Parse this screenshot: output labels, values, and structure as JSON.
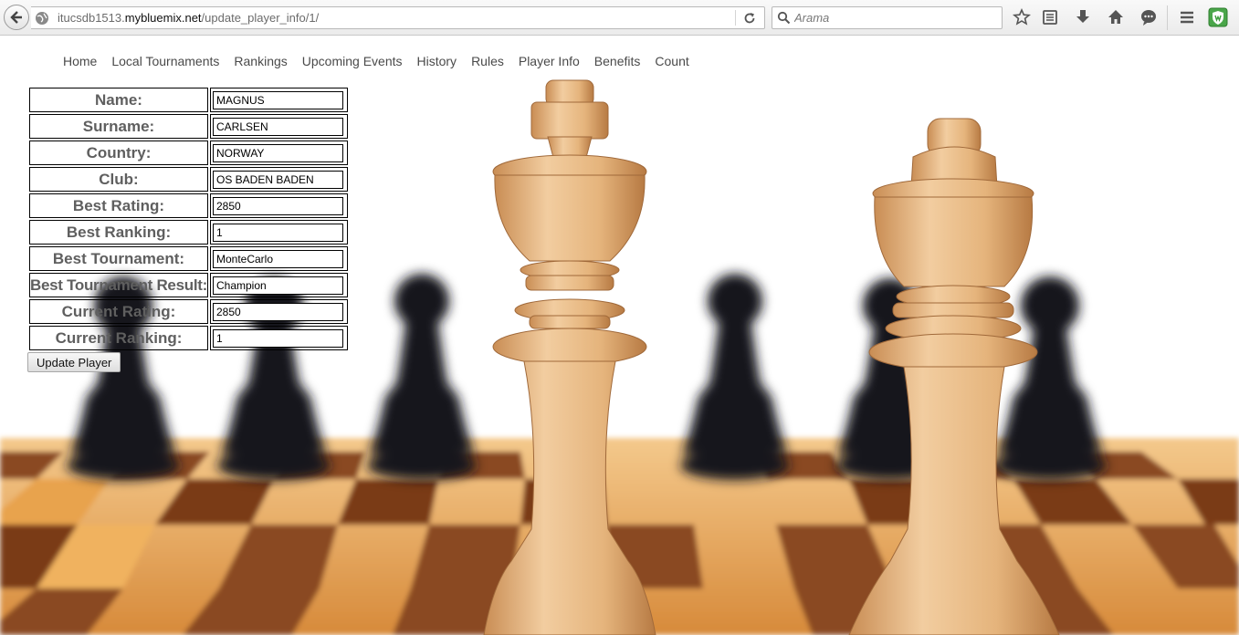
{
  "browser": {
    "url_prefix": "itucsdb1513.",
    "url_domain": "mybluemix.net",
    "url_path": "/update_player_info/1/",
    "search_placeholder": "Arama"
  },
  "nav": {
    "items": [
      "Home",
      "Local Tournaments",
      "Rankings",
      "Upcoming Events",
      "History",
      "Rules",
      "Player Info",
      "Benefits",
      "Count"
    ]
  },
  "form": {
    "rows": [
      {
        "label": "Name:",
        "value": "MAGNUS"
      },
      {
        "label": "Surname:",
        "value": "CARLSEN"
      },
      {
        "label": "Country:",
        "value": "NORWAY"
      },
      {
        "label": "Club:",
        "value": "OS BADEN BADEN"
      },
      {
        "label": "Best Rating:",
        "value": "2850"
      },
      {
        "label": "Best Ranking:",
        "value": "1"
      },
      {
        "label": "Best Tournament:",
        "value": "MonteCarlo"
      },
      {
        "label": "Best Tournament Result:",
        "value": "Champion"
      },
      {
        "label": "Current Rating:",
        "value": "2850"
      },
      {
        "label": "Current Ranking:",
        "value": "1"
      }
    ],
    "submit_label": "Update Player"
  },
  "background": {
    "subject": "chess king and queen on chessboard with black pawns",
    "board_light": "#e9a24a",
    "board_dark": "#7a3f18",
    "piece_wood": "#e3b27a"
  }
}
